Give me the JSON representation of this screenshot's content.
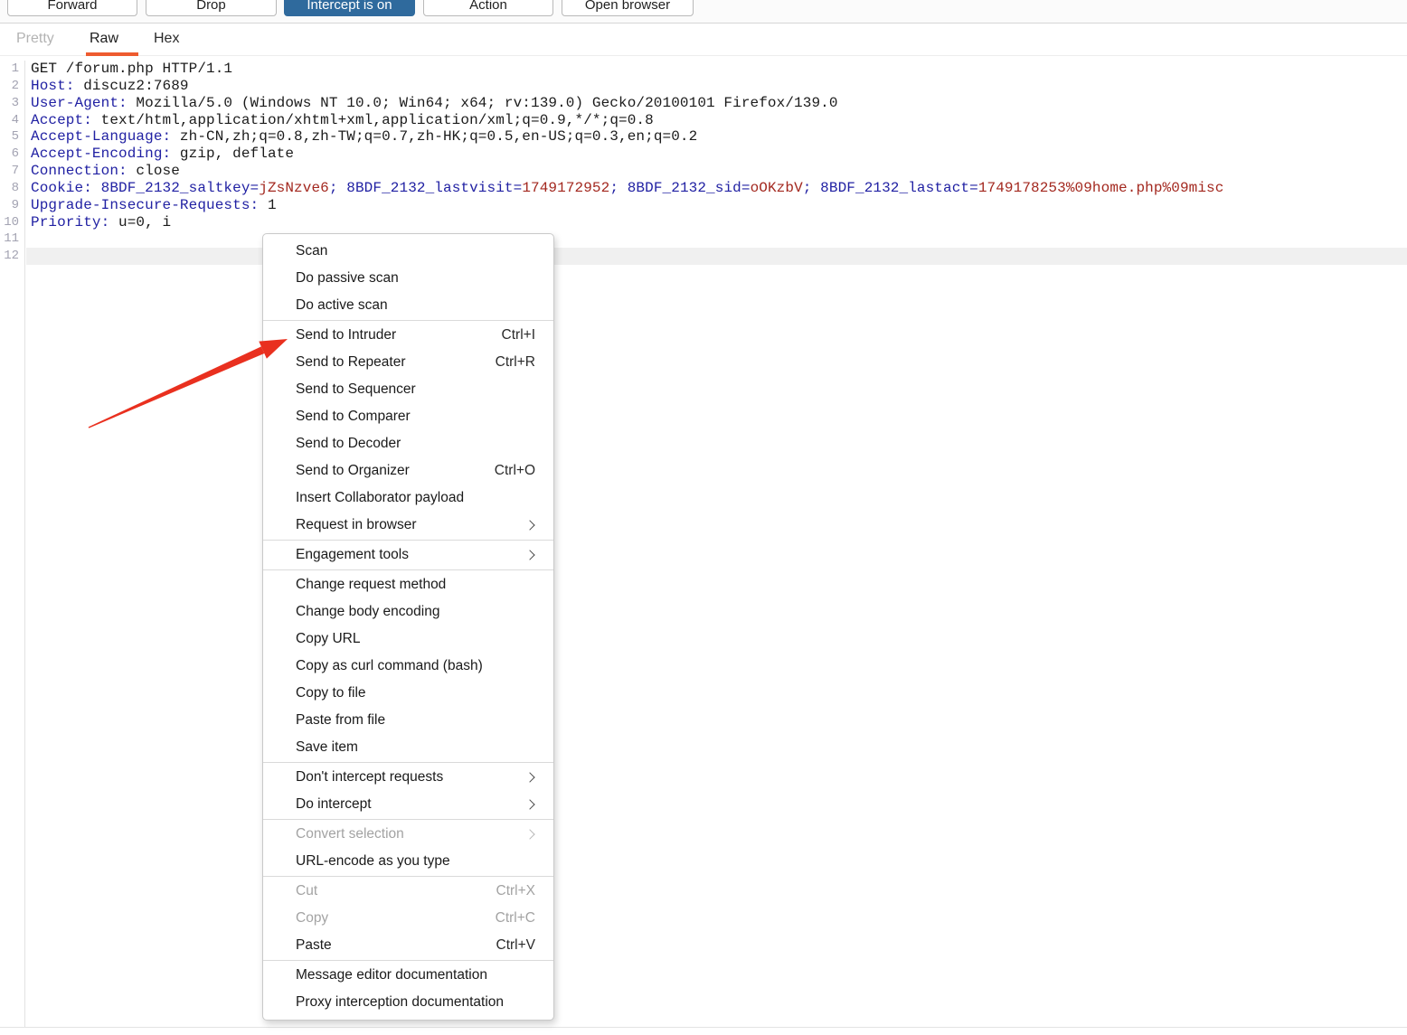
{
  "toolbar": {
    "buttons": [
      {
        "label": "Forward",
        "active": false
      },
      {
        "label": "Drop",
        "active": false
      },
      {
        "label": "Intercept is on",
        "active": true
      },
      {
        "label": "Action",
        "active": false
      },
      {
        "label": "Open browser",
        "active": false
      }
    ],
    "active_button_color": "#2f6a9d"
  },
  "tabs": [
    {
      "label": "Pretty",
      "state": "disabled"
    },
    {
      "label": "Raw",
      "state": "selected"
    },
    {
      "label": "Hex",
      "state": "normal"
    }
  ],
  "tab_accent_color": "#ee5b2f",
  "editor": {
    "highlighted_line": 12,
    "syntax_colors": {
      "header_name": "#2121a3",
      "cookie_value": "#a3281f",
      "plain": "#1b1b1b"
    },
    "lines": [
      {
        "num": 1,
        "segments": [
          {
            "c": "plain",
            "t": "GET /forum.php HTTP/1.1"
          }
        ]
      },
      {
        "num": 2,
        "segments": [
          {
            "c": "name",
            "t": "Host:"
          },
          {
            "c": "plain",
            "t": " discuz2:7689"
          }
        ]
      },
      {
        "num": 3,
        "segments": [
          {
            "c": "name",
            "t": "User-Agent:"
          },
          {
            "c": "plain",
            "t": " Mozilla/5.0 (Windows NT 10.0; Win64; x64; rv:139.0) Gecko/20100101 Firefox/139.0"
          }
        ]
      },
      {
        "num": 4,
        "segments": [
          {
            "c": "name",
            "t": "Accept:"
          },
          {
            "c": "plain",
            "t": " text/html,application/xhtml+xml,application/xml;q=0.9,*/*;q=0.8"
          }
        ]
      },
      {
        "num": 5,
        "segments": [
          {
            "c": "name",
            "t": "Accept-Language:"
          },
          {
            "c": "plain",
            "t": " zh-CN,zh;q=0.8,zh-TW;q=0.7,zh-HK;q=0.5,en-US;q=0.3,en;q=0.2"
          }
        ]
      },
      {
        "num": 6,
        "segments": [
          {
            "c": "name",
            "t": "Accept-Encoding:"
          },
          {
            "c": "plain",
            "t": " gzip, deflate"
          }
        ]
      },
      {
        "num": 7,
        "segments": [
          {
            "c": "name",
            "t": "Connection:"
          },
          {
            "c": "plain",
            "t": " close"
          }
        ]
      },
      {
        "num": 8,
        "segments": [
          {
            "c": "name",
            "t": "Cookie: 8BDF_2132_saltkey="
          },
          {
            "c": "value",
            "t": "jZsNzve6"
          },
          {
            "c": "name",
            "t": "; 8BDF_2132_lastvisit="
          },
          {
            "c": "value",
            "t": "1749172952"
          },
          {
            "c": "name",
            "t": "; 8BDF_2132_sid="
          },
          {
            "c": "value",
            "t": "oOKzbV"
          },
          {
            "c": "name",
            "t": "; 8BDF_2132_lastact="
          },
          {
            "c": "value",
            "t": "1749178253%09home.php%09misc"
          }
        ]
      },
      {
        "num": 9,
        "segments": [
          {
            "c": "name",
            "t": "Upgrade-Insecure-Requests:"
          },
          {
            "c": "plain",
            "t": " 1"
          }
        ]
      },
      {
        "num": 10,
        "segments": [
          {
            "c": "name",
            "t": "Priority:"
          },
          {
            "c": "plain",
            "t": " u=0, i"
          }
        ]
      },
      {
        "num": 11,
        "segments": []
      },
      {
        "num": 12,
        "segments": [],
        "highlight": true
      }
    ]
  },
  "context_menu": {
    "items": [
      {
        "label": "Scan"
      },
      {
        "label": "Do passive scan"
      },
      {
        "label": "Do active scan"
      },
      {
        "type": "separator"
      },
      {
        "label": "Send to Intruder",
        "shortcut": "Ctrl+I"
      },
      {
        "label": "Send to Repeater",
        "shortcut": "Ctrl+R"
      },
      {
        "label": "Send to Sequencer"
      },
      {
        "label": "Send to Comparer"
      },
      {
        "label": "Send to Decoder"
      },
      {
        "label": "Send to Organizer",
        "shortcut": "Ctrl+O"
      },
      {
        "label": "Insert Collaborator payload"
      },
      {
        "label": "Request in browser",
        "submenu": true
      },
      {
        "type": "separator"
      },
      {
        "label": "Engagement tools",
        "submenu": true
      },
      {
        "type": "separator"
      },
      {
        "label": "Change request method"
      },
      {
        "label": "Change body encoding"
      },
      {
        "label": "Copy URL"
      },
      {
        "label": "Copy as curl command (bash)"
      },
      {
        "label": "Copy to file"
      },
      {
        "label": "Paste from file"
      },
      {
        "label": "Save item"
      },
      {
        "type": "separator"
      },
      {
        "label": "Don't intercept requests",
        "submenu": true
      },
      {
        "label": "Do intercept",
        "submenu": true
      },
      {
        "type": "separator"
      },
      {
        "label": "Convert selection",
        "submenu": true,
        "disabled": true
      },
      {
        "label": "URL-encode as you type"
      },
      {
        "type": "separator"
      },
      {
        "label": "Cut",
        "shortcut": "Ctrl+X",
        "disabled": true
      },
      {
        "label": "Copy",
        "shortcut": "Ctrl+C",
        "disabled": true
      },
      {
        "label": "Paste",
        "shortcut": "Ctrl+V"
      },
      {
        "type": "separator"
      },
      {
        "label": "Message editor documentation"
      },
      {
        "label": "Proxy interception documentation"
      }
    ]
  },
  "annotation": {
    "type": "red-arrow",
    "points_to": "Send to Intruder",
    "color": "#e9301f"
  }
}
